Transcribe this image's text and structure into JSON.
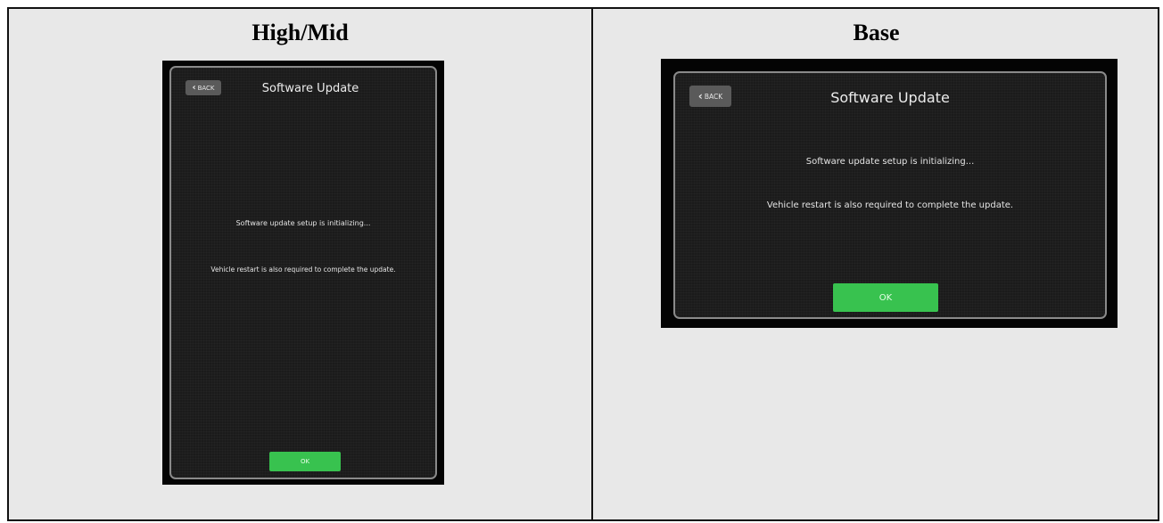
{
  "columns": {
    "left_title": "High/Mid",
    "right_title": "Base"
  },
  "high_mid": {
    "back_label": "BACK",
    "title": "Software Update",
    "message1": "Software update setup is initializing...",
    "message2": "Vehicle restart is also required to complete the update.",
    "ok_label": "OK"
  },
  "base": {
    "back_label": "BACK",
    "title": "Software Update",
    "message1": "Software update setup is initializing...",
    "message2": "Vehicle restart is also required to complete the update.",
    "ok_label": "OK"
  },
  "colors": {
    "ok_green": "#38c24f",
    "screen_bg": "#1b1b1b",
    "cell_bg": "#e8e8e8"
  }
}
